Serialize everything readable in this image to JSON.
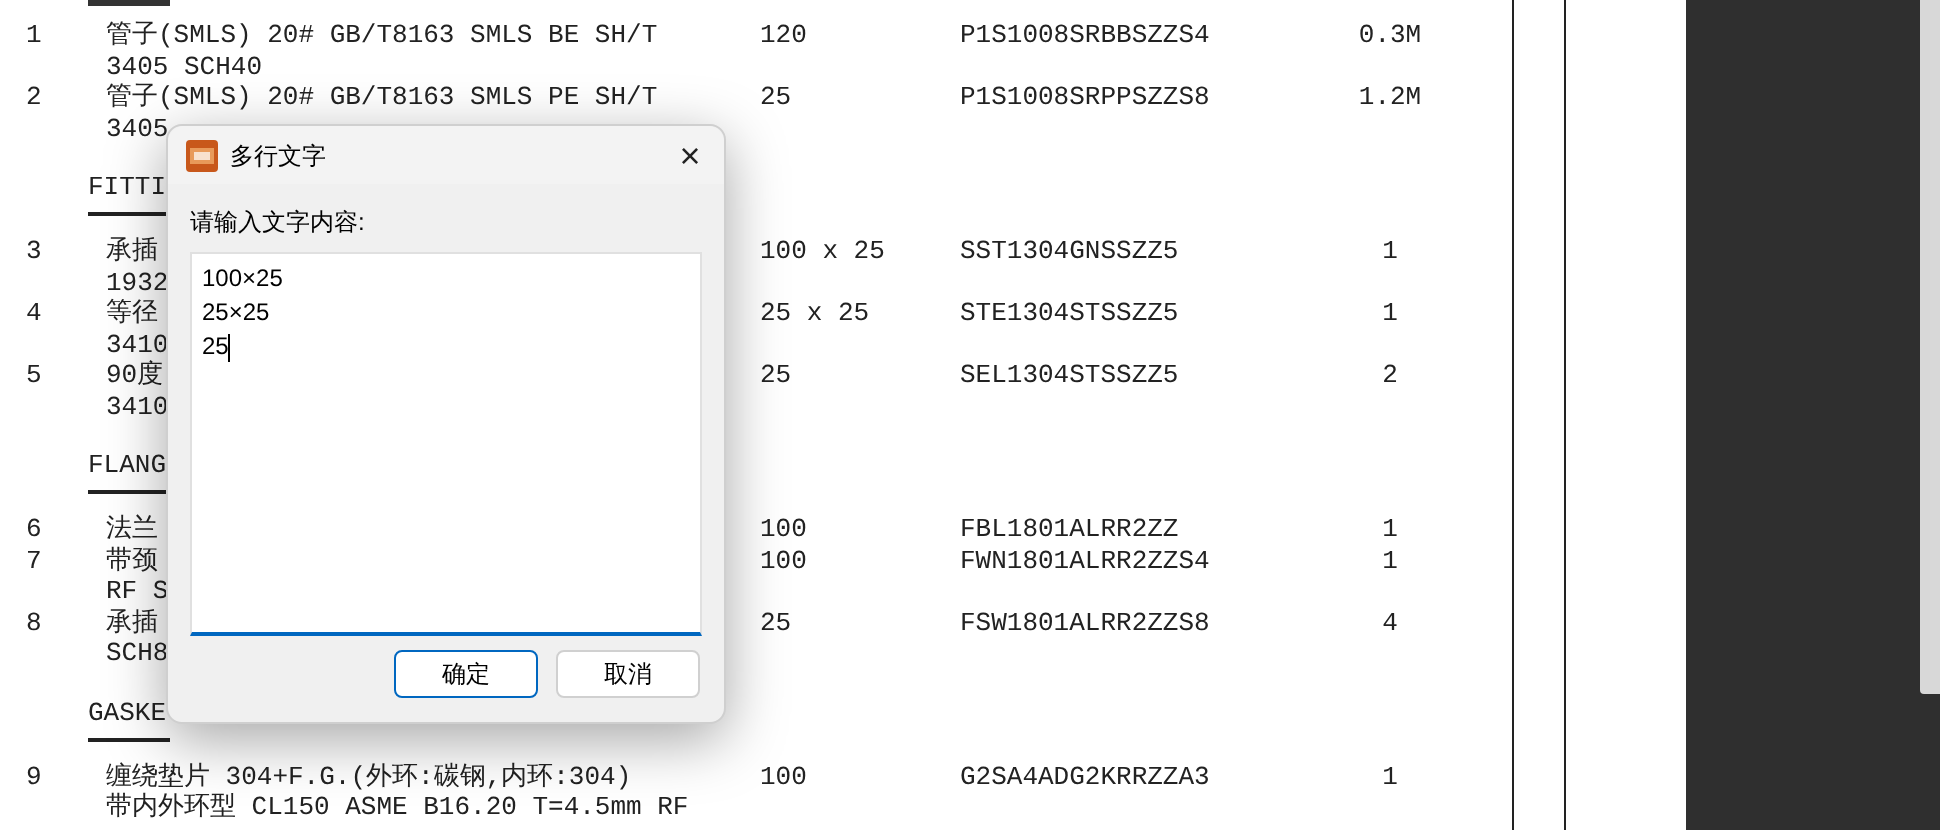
{
  "document": {
    "rows": [
      {
        "kind": "item",
        "number": "1",
        "lines": [
          "管子(SMLS) 20# GB/T8163 SMLS BE SH/T",
          "3405 SCH40"
        ],
        "size": "120",
        "code": "P1S1008SRBBSZZS4",
        "qty": "0.3M"
      },
      {
        "kind": "item",
        "number": "2",
        "lines": [
          "管子(SMLS) 20# GB/T8163 SMLS PE SH/T",
          "3405"
        ],
        "size": "25",
        "code": "P1S1008SRPPSZZS8",
        "qty": "1.2M"
      },
      {
        "kind": "section",
        "title": "FITTI"
      },
      {
        "kind": "item",
        "number": "3",
        "lines": [
          "承插",
          "1932"
        ],
        "size": "100 x 25",
        "code": "SST1304GNSSZZ5",
        "qty": "1"
      },
      {
        "kind": "item",
        "number": "4",
        "lines": [
          "等径",
          "3410"
        ],
        "size": "25 x 25",
        "code": "STE1304STSSZZ5",
        "qty": "1"
      },
      {
        "kind": "item",
        "number": "5",
        "lines": [
          "90度",
          "3410"
        ],
        "size": "25",
        "code": "SEL1304STSSZZ5",
        "qty": "2"
      },
      {
        "kind": "section",
        "title": "FLANG"
      },
      {
        "kind": "item",
        "number": "6",
        "lines": [
          "法兰"
        ],
        "size": "100",
        "code": "FBL1801ALRR2ZZ",
        "qty": "1"
      },
      {
        "kind": "item",
        "number": "7",
        "lines": [
          "带颈",
          "RF S"
        ],
        "size": "100",
        "code": "FWN1801ALRR2ZZS4",
        "qty": "1"
      },
      {
        "kind": "item",
        "number": "8",
        "lines": [
          "承插",
          "SCH8"
        ],
        "size": "25",
        "code": "FSW1801ALRR2ZZS8",
        "qty": "4"
      },
      {
        "kind": "section",
        "title": "GASKE"
      },
      {
        "kind": "item",
        "number": "9",
        "lines": [
          "缠绕垫片 304+F.G.(外环:碳钢,内环:304)",
          "带内外环型 CL150 ASME B16.20 T=4.5mm RF"
        ],
        "size": "100",
        "code": "G2SA4ADG2KRRZZA3",
        "qty": "1"
      }
    ]
  },
  "dialog": {
    "title": "多行文字",
    "close": "×",
    "prompt": "请输入文字内容:",
    "lines": [
      "100×25",
      "25×25",
      "25"
    ],
    "buttons": [
      {
        "label": "确定",
        "default": true
      },
      {
        "label": "取消",
        "default": false
      }
    ]
  }
}
